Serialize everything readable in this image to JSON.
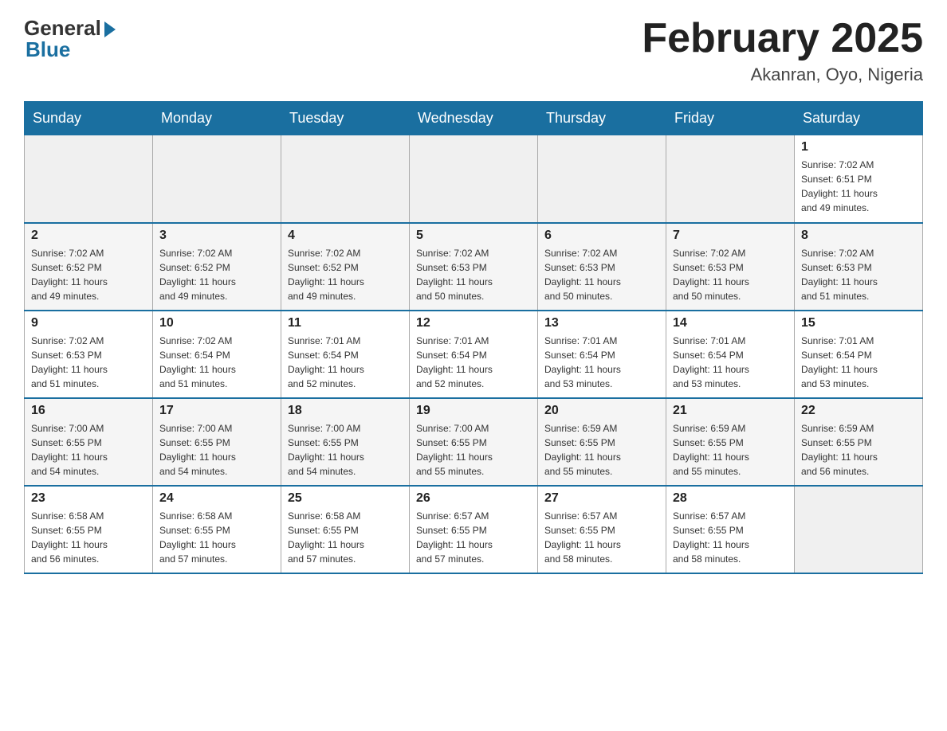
{
  "header": {
    "logo_general": "General",
    "logo_blue": "Blue",
    "title": "February 2025",
    "location": "Akanran, Oyo, Nigeria"
  },
  "days_of_week": [
    "Sunday",
    "Monday",
    "Tuesday",
    "Wednesday",
    "Thursday",
    "Friday",
    "Saturday"
  ],
  "weeks": [
    {
      "days": [
        {
          "number": "",
          "info": ""
        },
        {
          "number": "",
          "info": ""
        },
        {
          "number": "",
          "info": ""
        },
        {
          "number": "",
          "info": ""
        },
        {
          "number": "",
          "info": ""
        },
        {
          "number": "",
          "info": ""
        },
        {
          "number": "1",
          "info": "Sunrise: 7:02 AM\nSunset: 6:51 PM\nDaylight: 11 hours\nand 49 minutes."
        }
      ]
    },
    {
      "days": [
        {
          "number": "2",
          "info": "Sunrise: 7:02 AM\nSunset: 6:52 PM\nDaylight: 11 hours\nand 49 minutes."
        },
        {
          "number": "3",
          "info": "Sunrise: 7:02 AM\nSunset: 6:52 PM\nDaylight: 11 hours\nand 49 minutes."
        },
        {
          "number": "4",
          "info": "Sunrise: 7:02 AM\nSunset: 6:52 PM\nDaylight: 11 hours\nand 49 minutes."
        },
        {
          "number": "5",
          "info": "Sunrise: 7:02 AM\nSunset: 6:53 PM\nDaylight: 11 hours\nand 50 minutes."
        },
        {
          "number": "6",
          "info": "Sunrise: 7:02 AM\nSunset: 6:53 PM\nDaylight: 11 hours\nand 50 minutes."
        },
        {
          "number": "7",
          "info": "Sunrise: 7:02 AM\nSunset: 6:53 PM\nDaylight: 11 hours\nand 50 minutes."
        },
        {
          "number": "8",
          "info": "Sunrise: 7:02 AM\nSunset: 6:53 PM\nDaylight: 11 hours\nand 51 minutes."
        }
      ]
    },
    {
      "days": [
        {
          "number": "9",
          "info": "Sunrise: 7:02 AM\nSunset: 6:53 PM\nDaylight: 11 hours\nand 51 minutes."
        },
        {
          "number": "10",
          "info": "Sunrise: 7:02 AM\nSunset: 6:54 PM\nDaylight: 11 hours\nand 51 minutes."
        },
        {
          "number": "11",
          "info": "Sunrise: 7:01 AM\nSunset: 6:54 PM\nDaylight: 11 hours\nand 52 minutes."
        },
        {
          "number": "12",
          "info": "Sunrise: 7:01 AM\nSunset: 6:54 PM\nDaylight: 11 hours\nand 52 minutes."
        },
        {
          "number": "13",
          "info": "Sunrise: 7:01 AM\nSunset: 6:54 PM\nDaylight: 11 hours\nand 53 minutes."
        },
        {
          "number": "14",
          "info": "Sunrise: 7:01 AM\nSunset: 6:54 PM\nDaylight: 11 hours\nand 53 minutes."
        },
        {
          "number": "15",
          "info": "Sunrise: 7:01 AM\nSunset: 6:54 PM\nDaylight: 11 hours\nand 53 minutes."
        }
      ]
    },
    {
      "days": [
        {
          "number": "16",
          "info": "Sunrise: 7:00 AM\nSunset: 6:55 PM\nDaylight: 11 hours\nand 54 minutes."
        },
        {
          "number": "17",
          "info": "Sunrise: 7:00 AM\nSunset: 6:55 PM\nDaylight: 11 hours\nand 54 minutes."
        },
        {
          "number": "18",
          "info": "Sunrise: 7:00 AM\nSunset: 6:55 PM\nDaylight: 11 hours\nand 54 minutes."
        },
        {
          "number": "19",
          "info": "Sunrise: 7:00 AM\nSunset: 6:55 PM\nDaylight: 11 hours\nand 55 minutes."
        },
        {
          "number": "20",
          "info": "Sunrise: 6:59 AM\nSunset: 6:55 PM\nDaylight: 11 hours\nand 55 minutes."
        },
        {
          "number": "21",
          "info": "Sunrise: 6:59 AM\nSunset: 6:55 PM\nDaylight: 11 hours\nand 55 minutes."
        },
        {
          "number": "22",
          "info": "Sunrise: 6:59 AM\nSunset: 6:55 PM\nDaylight: 11 hours\nand 56 minutes."
        }
      ]
    },
    {
      "days": [
        {
          "number": "23",
          "info": "Sunrise: 6:58 AM\nSunset: 6:55 PM\nDaylight: 11 hours\nand 56 minutes."
        },
        {
          "number": "24",
          "info": "Sunrise: 6:58 AM\nSunset: 6:55 PM\nDaylight: 11 hours\nand 57 minutes."
        },
        {
          "number": "25",
          "info": "Sunrise: 6:58 AM\nSunset: 6:55 PM\nDaylight: 11 hours\nand 57 minutes."
        },
        {
          "number": "26",
          "info": "Sunrise: 6:57 AM\nSunset: 6:55 PM\nDaylight: 11 hours\nand 57 minutes."
        },
        {
          "number": "27",
          "info": "Sunrise: 6:57 AM\nSunset: 6:55 PM\nDaylight: 11 hours\nand 58 minutes."
        },
        {
          "number": "28",
          "info": "Sunrise: 6:57 AM\nSunset: 6:55 PM\nDaylight: 11 hours\nand 58 minutes."
        },
        {
          "number": "",
          "info": ""
        }
      ]
    }
  ]
}
